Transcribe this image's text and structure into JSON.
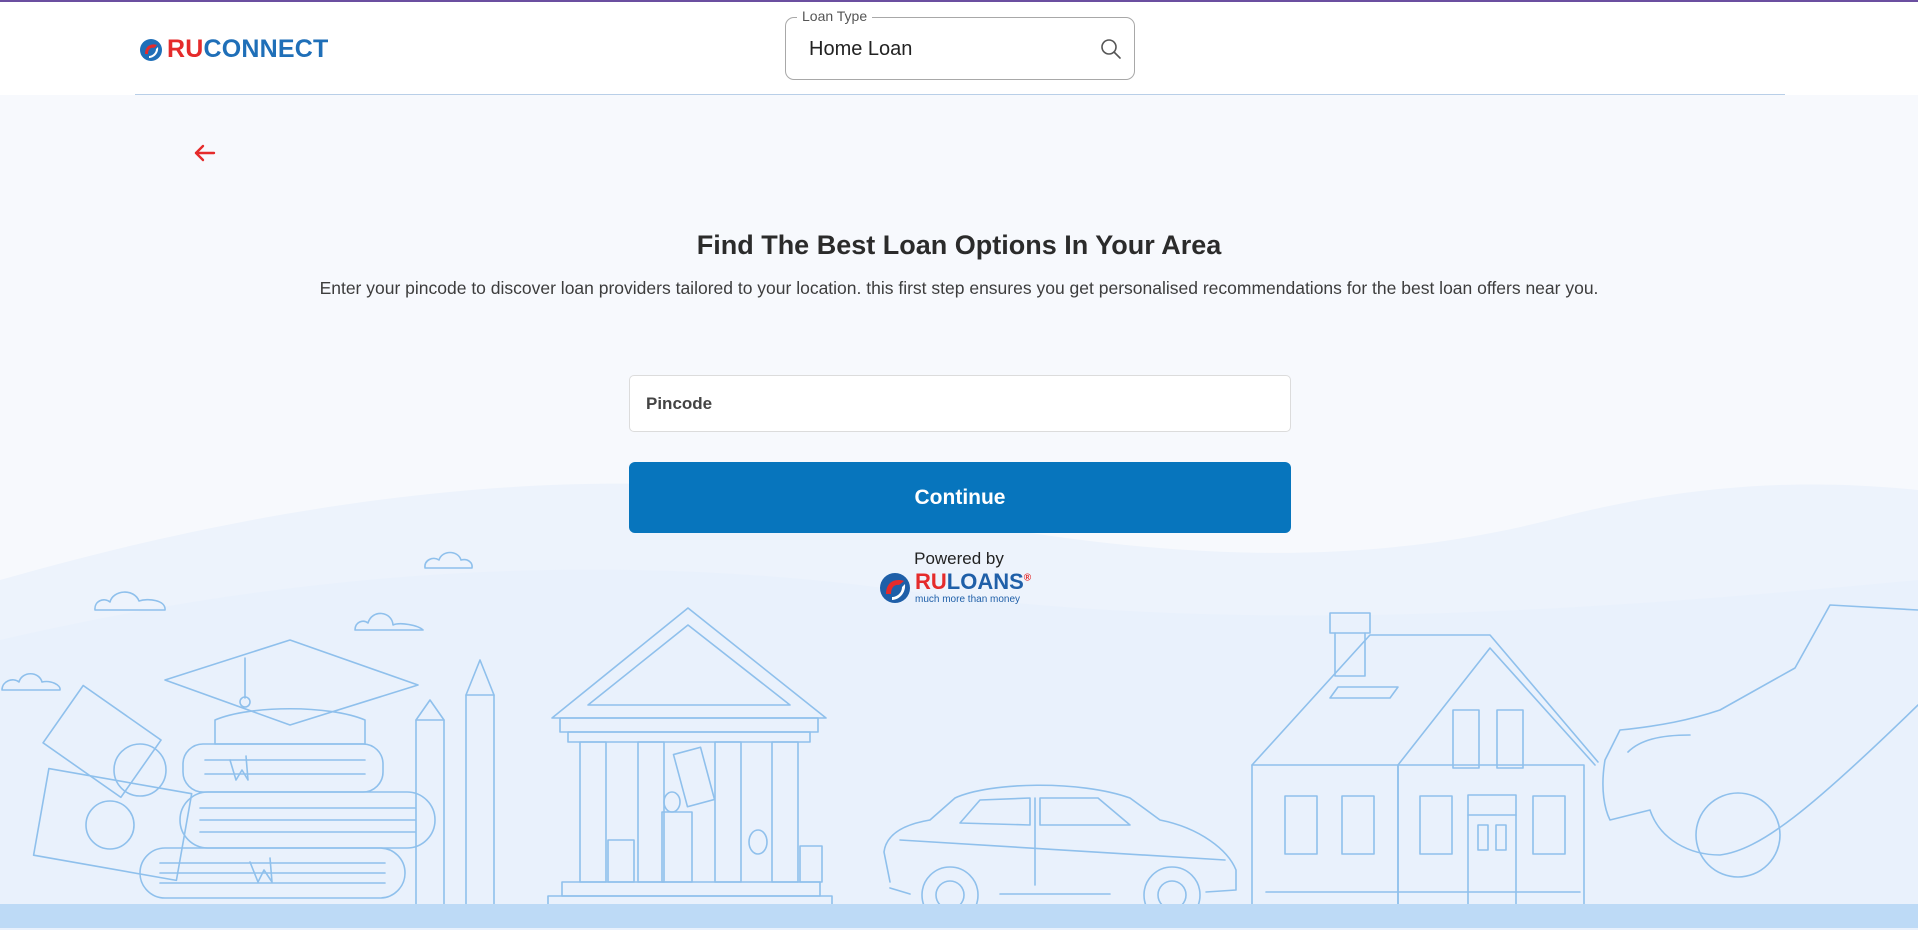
{
  "header": {
    "logo_ru": "RU",
    "logo_connect": "CONNECT",
    "loan_type": {
      "label": "Loan Type",
      "value": "Home Loan",
      "icon": "search-icon"
    }
  },
  "nav": {
    "back_icon": "arrow-left-icon"
  },
  "hero": {
    "title": "Find The Best Loan Options In Your Area",
    "subtitle": "Enter your pincode to discover loan providers tailored to your location. this first step ensures you get personalised recommendations for the best loan offers near you."
  },
  "form": {
    "pincode_placeholder": "Pincode",
    "pincode_value": "",
    "continue_label": "Continue"
  },
  "footer": {
    "powered_by": "Powered by",
    "brand_ru": "RU",
    "brand_loans": "LOANS",
    "brand_reg": "®",
    "tagline": "much more than money"
  },
  "colors": {
    "primary": "#0775bd",
    "brand_red": "#e52b2b",
    "brand_blue": "#1f6fb8",
    "illustration_stroke": "#8fc0ec"
  }
}
